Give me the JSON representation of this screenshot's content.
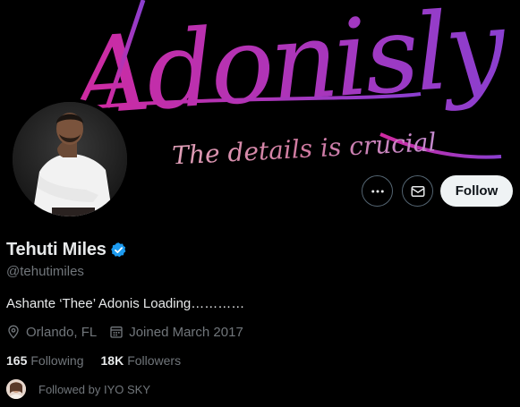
{
  "banner": {
    "title": "Adonisly",
    "tagline": "The details is crucial"
  },
  "actions": {
    "more_icon": "more-horizontal-icon",
    "message_icon": "envelope-icon",
    "follow_label": "Follow"
  },
  "profile": {
    "display_name": "Tehuti Miles",
    "verified_icon": "verified-badge-icon",
    "handle": "@tehutimiles",
    "bio": "Ashante ‘Thee’ Adonis Loading…………",
    "location": "Orlando, FL",
    "location_icon": "location-pin-icon",
    "joined": "Joined March 2017",
    "joined_icon": "calendar-icon",
    "following_count": "165",
    "following_label": "Following",
    "followers_count": "18K",
    "followers_label": "Followers",
    "followed_by": "Followed by IYO SKY"
  },
  "colors": {
    "background": "#000000",
    "text_primary": "#e7e9ea",
    "text_secondary": "#71767b",
    "verified": "#1d9bf0",
    "banner_accent_start": "#d02aa0",
    "banner_accent_end": "#8a3fd0",
    "follow_button_bg": "#eff3f4"
  }
}
